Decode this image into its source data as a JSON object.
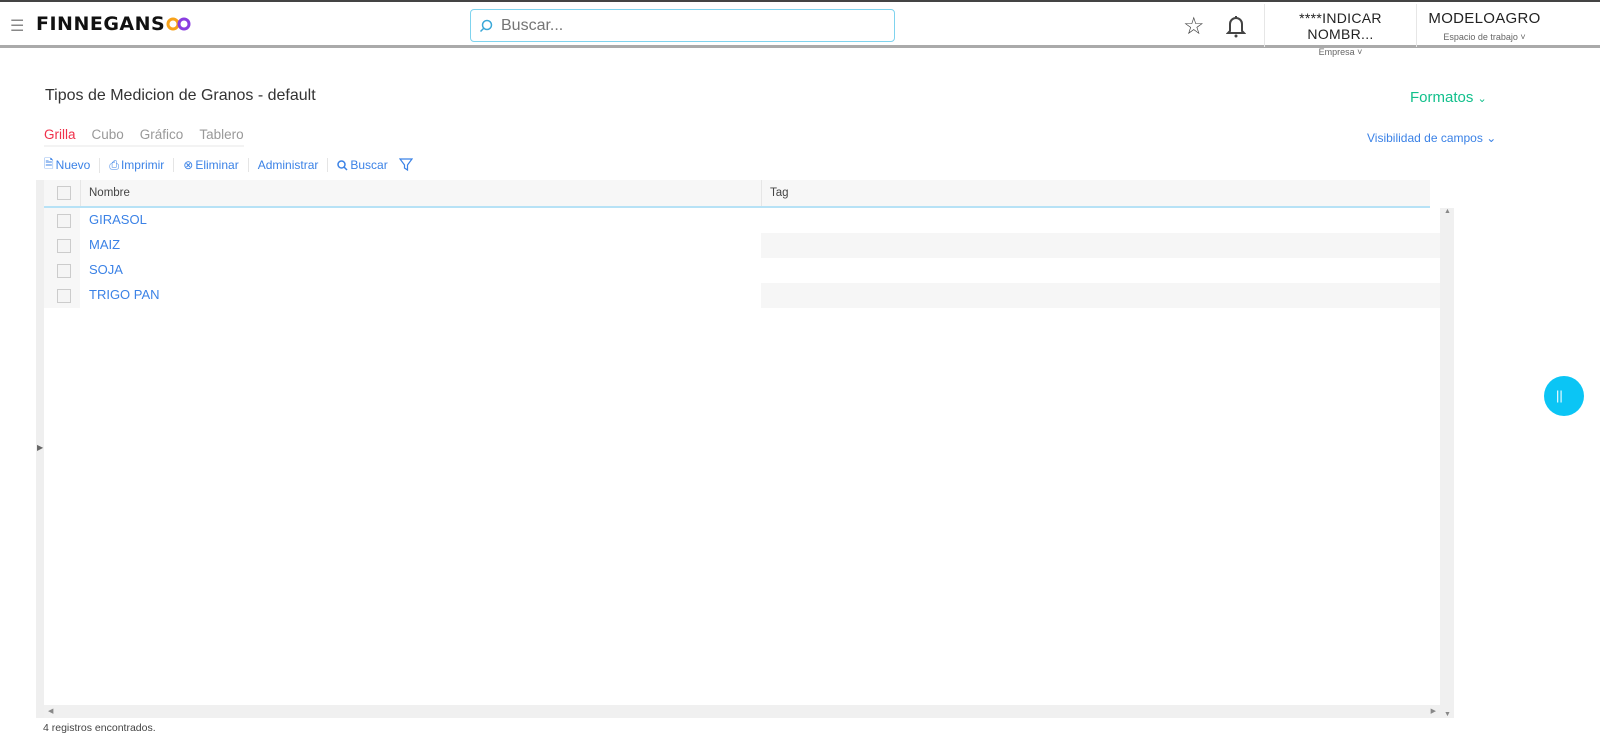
{
  "header": {
    "brand": "FINNEGANS",
    "search_placeholder": "Buscar...",
    "company": "****INDICAR NOMBR...",
    "company_label": "Empresa",
    "workspace": "MODELOAGRO",
    "workspace_label": "Espacio de trabajo"
  },
  "page": {
    "title": "Tipos de Medicion de Granos - default",
    "formatos": "Formatos",
    "visibilidad": "Visibilidad de campos"
  },
  "tabs": [
    "Grilla",
    "Cubo",
    "Gráfico",
    "Tablero"
  ],
  "toolbar": {
    "nuevo": "Nuevo",
    "imprimir": "Imprimir",
    "eliminar": "Eliminar",
    "administrar": "Administrar",
    "buscar": "Buscar"
  },
  "grid": {
    "columns": [
      "Nombre",
      "Tag"
    ],
    "rows": [
      {
        "nombre": "GIRASOL",
        "tag": ""
      },
      {
        "nombre": "MAIZ",
        "tag": ""
      },
      {
        "nombre": "SOJA",
        "tag": ""
      },
      {
        "nombre": "TRIGO PAN",
        "tag": ""
      }
    ]
  },
  "footer": "4 registros encontrados.",
  "colors": {
    "accent": "#3b82e6",
    "active_tab": "#f0304a",
    "formatos": "#12c08c",
    "fab": "#0bc5f5"
  }
}
